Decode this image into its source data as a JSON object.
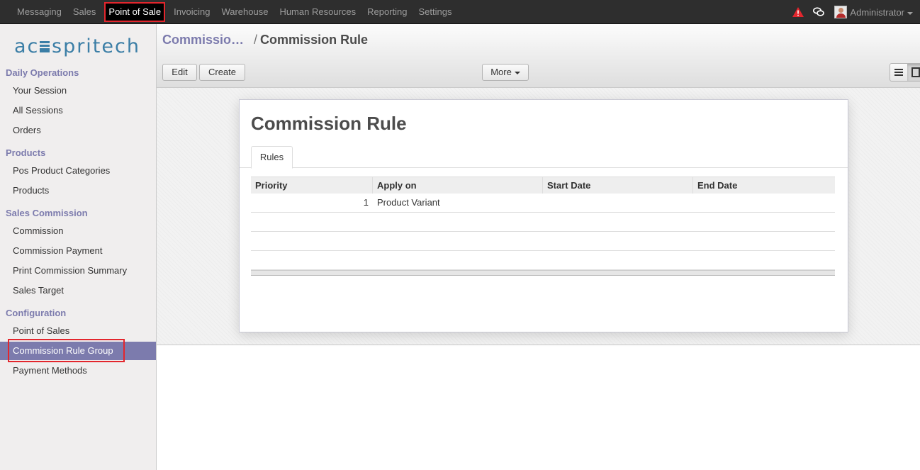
{
  "topnav": {
    "items": [
      {
        "label": "Messaging",
        "active": false
      },
      {
        "label": "Sales",
        "active": false
      },
      {
        "label": "Point of Sale",
        "active": true
      },
      {
        "label": "Invoicing",
        "active": false
      },
      {
        "label": "Warehouse",
        "active": false
      },
      {
        "label": "Human Resources",
        "active": false
      },
      {
        "label": "Reporting",
        "active": false
      },
      {
        "label": "Settings",
        "active": false
      }
    ],
    "user": "Administrator"
  },
  "sidebar": {
    "logo": "acespritech",
    "sections": [
      {
        "title": "Daily Operations",
        "items": [
          "Your Session",
          "All Sessions",
          "Orders"
        ]
      },
      {
        "title": "Products",
        "items": [
          "Pos Product Categories",
          "Products"
        ]
      },
      {
        "title": "Sales Commission",
        "items": [
          "Commission",
          "Commission Payment",
          "Print Commission Summary",
          "Sales Target"
        ]
      },
      {
        "title": "Configuration",
        "items": [
          "Point of Sales",
          "Commission Rule Group",
          "Payment Methods"
        ]
      }
    ],
    "selected": "Commission Rule Group"
  },
  "breadcrumb": {
    "parent": "Commissio…",
    "separator": "/",
    "current": "Commission Rule"
  },
  "toolbar": {
    "edit": "Edit",
    "create": "Create",
    "more": "More"
  },
  "form": {
    "title": "Commission Rule",
    "tab": "Rules",
    "columns": [
      "Priority",
      "Apply on",
      "Start Date",
      "End Date"
    ],
    "rows": [
      {
        "priority": "1",
        "apply_on": "Product Variant",
        "start_date": "",
        "end_date": ""
      }
    ]
  },
  "colors": {
    "accent": "#7c7bad",
    "highlight": "#e3262d",
    "navbar": "#2e2e2e"
  }
}
